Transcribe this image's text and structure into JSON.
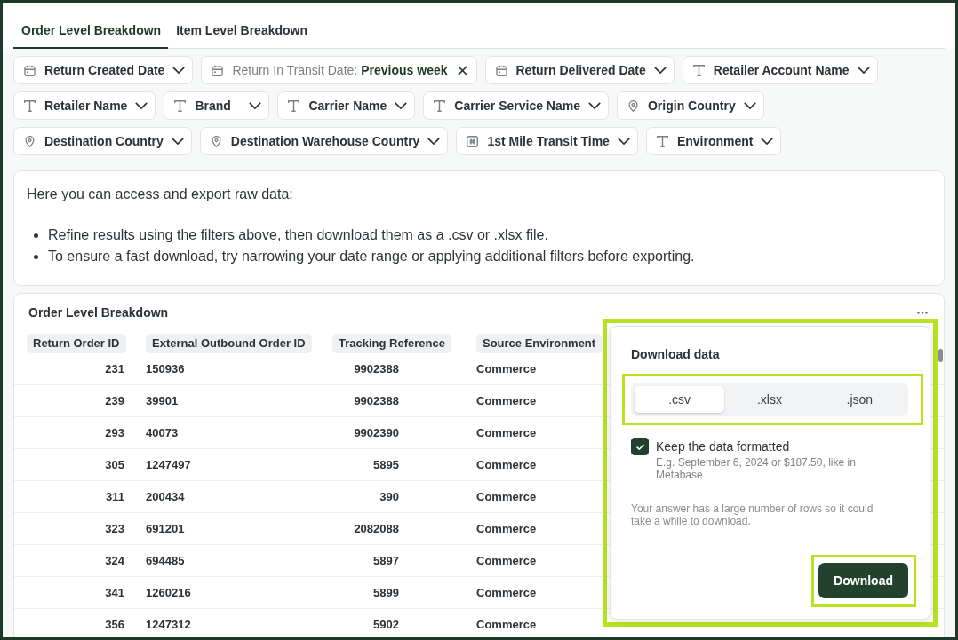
{
  "tabs": [
    {
      "label": "Order Level Breakdown",
      "selected": true
    },
    {
      "label": "Item Level Breakdown",
      "selected": false
    }
  ],
  "filters": [
    {
      "kind": "date",
      "label": "Return Created Date",
      "active": false
    },
    {
      "kind": "date",
      "label": "Return In Transit Date:",
      "value": "Previous week",
      "active": true
    },
    {
      "kind": "date",
      "label": "Return Delivered Date",
      "active": false
    },
    {
      "kind": "text",
      "label": "Retailer Account Name",
      "active": false
    },
    {
      "kind": "text",
      "label": "Retailer Name",
      "active": false
    },
    {
      "kind": "text",
      "label": "Brand",
      "active": false
    },
    {
      "kind": "text",
      "label": "Carrier Name",
      "active": false
    },
    {
      "kind": "text",
      "label": "Carrier Service Name",
      "active": false
    },
    {
      "kind": "location",
      "label": "Origin Country",
      "active": false
    },
    {
      "kind": "location",
      "label": "Destination Country",
      "active": false
    },
    {
      "kind": "location",
      "label": "Destination Warehouse Country",
      "active": false
    },
    {
      "kind": "number",
      "label": "1st Mile Transit Time",
      "active": false
    },
    {
      "kind": "text",
      "label": "Environment",
      "active": false
    }
  ],
  "info": {
    "intro": "Here you can access and export raw data:",
    "bullets": [
      "Refine results using the filters above, then download them as a .csv or .xlsx file.",
      "To ensure a fast download, try narrowing your date range or applying additional filters before exporting."
    ]
  },
  "table": {
    "title": "Order Level Breakdown",
    "columns": [
      "Return Order ID",
      "External Outbound Order ID",
      "Tracking Reference",
      "Source Environment"
    ],
    "rows": [
      [
        "231",
        "150936",
        "9902388",
        "Commerce"
      ],
      [
        "239",
        "39901",
        "9902388",
        "Commerce"
      ],
      [
        "293",
        "40073",
        "9902390",
        "Commerce"
      ],
      [
        "305",
        "1247497",
        "5895",
        "Commerce"
      ],
      [
        "311",
        "200434",
        "390",
        "Commerce"
      ],
      [
        "323",
        "691201",
        "2082088",
        "Commerce"
      ],
      [
        "324",
        "694485",
        "5897",
        "Commerce"
      ],
      [
        "341",
        "1260216",
        "5899",
        "Commerce"
      ],
      [
        "356",
        "1247312",
        "5902",
        "Commerce"
      ]
    ]
  },
  "download_popup": {
    "highlighted": true,
    "title": "Download data",
    "formats": {
      "highlighted": true,
      "options": [
        {
          "label": ".csv",
          "selected": true
        },
        {
          "label": ".xlsx",
          "selected": false
        },
        {
          "label": ".json",
          "selected": false
        }
      ]
    },
    "keep_formatted": {
      "label": "Keep the data formatted",
      "hint": "E.g. September 6, 2024 or $187.50, like in Metabase",
      "checked": true
    },
    "note": "Your answer has a large number of rows so it could take a while to download.",
    "download_button": {
      "label": "Download",
      "highlighted": true
    }
  }
}
